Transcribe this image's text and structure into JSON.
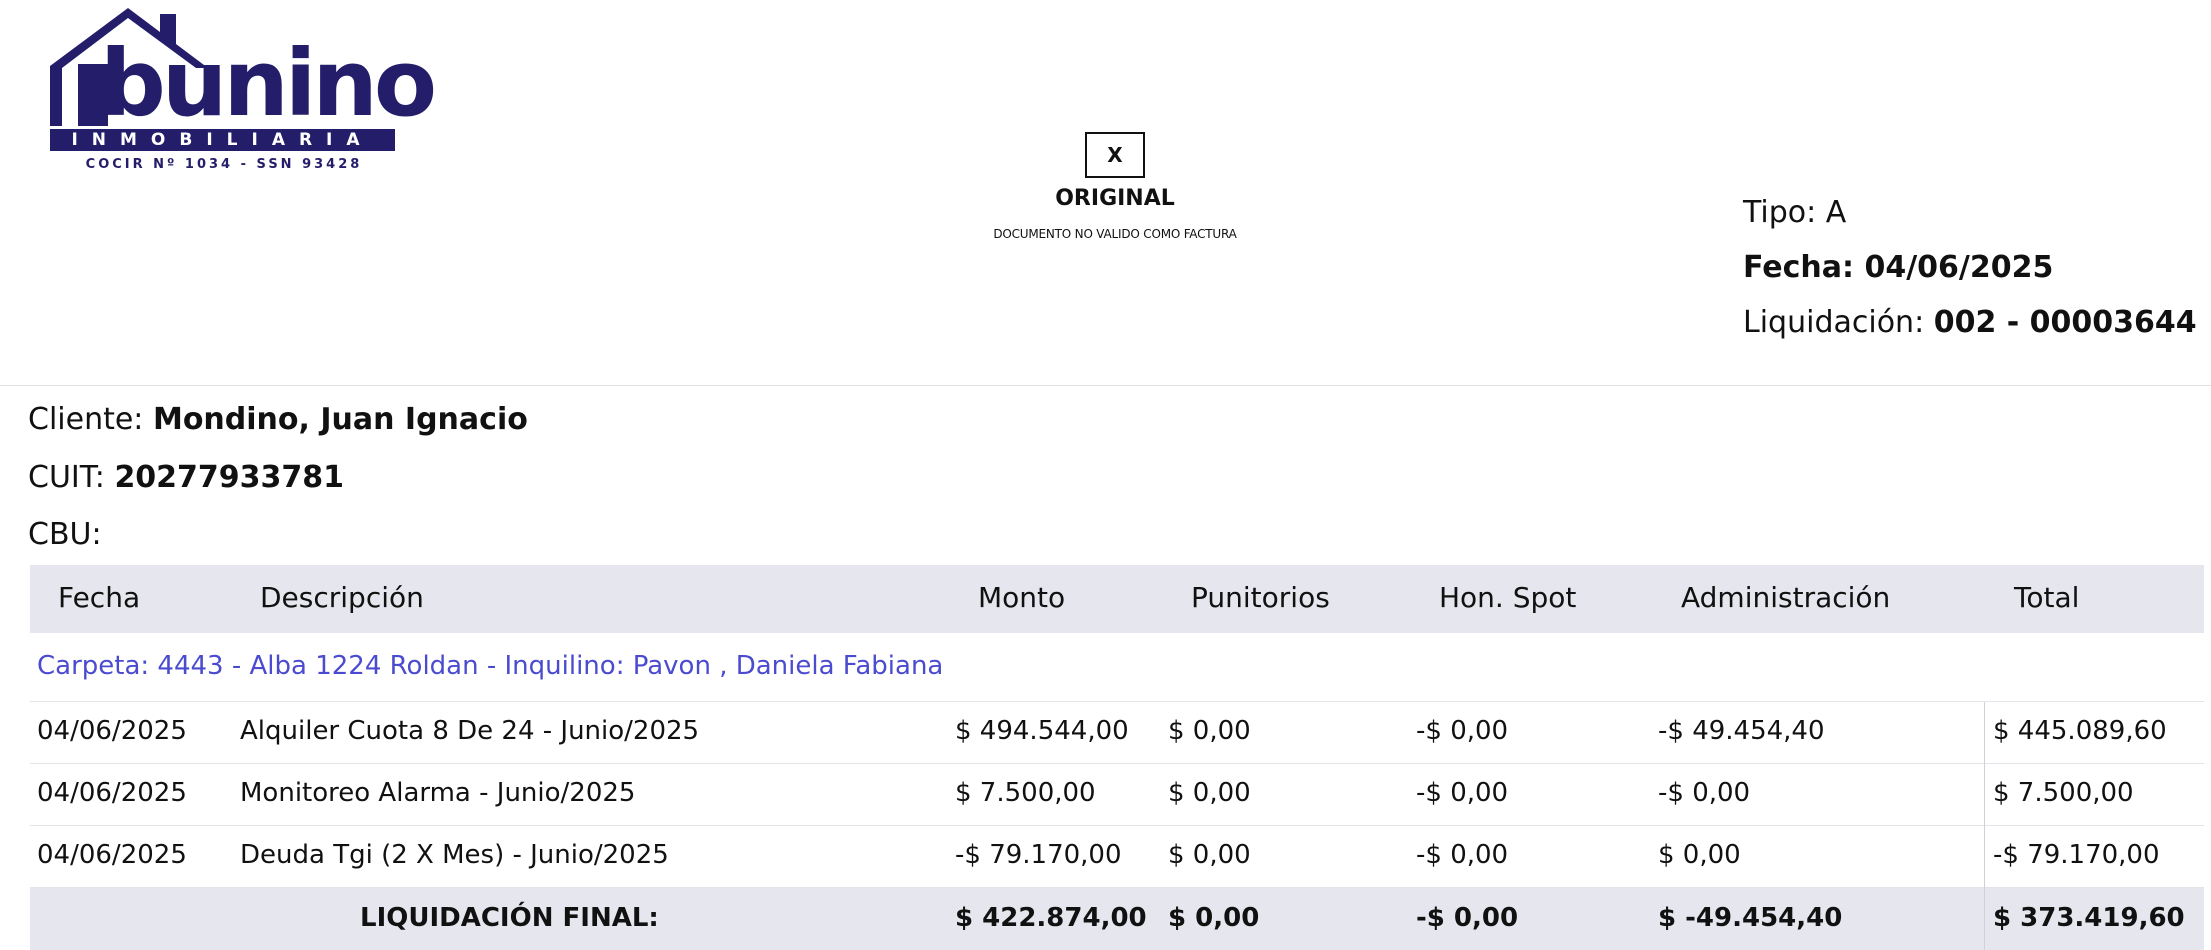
{
  "logo": {
    "brand": "bunino",
    "subtitle": "INMOBILIARIA",
    "registration": "COCIR Nº 1034 - SSN 93428",
    "color": "#241d6a"
  },
  "document": {
    "copy_mark": "X",
    "copy_label": "ORIGINAL",
    "note": "DOCUMENTO NO VALIDO COMO FACTURA"
  },
  "meta": {
    "tipo_label": "Tipo:",
    "tipo_value": "A",
    "fecha_label": "Fecha:",
    "fecha_value": "04/06/2025",
    "liquidacion_label": "Liquidación:",
    "liquidacion_value": "002 - 00003644"
  },
  "client": {
    "cliente_label": "Cliente:",
    "cliente_value": "Mondino, Juan Ignacio",
    "cuit_label": "CUIT:",
    "cuit_value": "20277933781",
    "cbu_label": "CBU:",
    "cbu_value": ""
  },
  "table": {
    "headers": [
      "Fecha",
      "Descripción",
      "Monto",
      "Punitorios",
      "Hon. Spot",
      "Administración",
      "Total"
    ],
    "carpeta": "Carpeta: 4443 - Alba 1224 Roldan - Inquilino: Pavon , Daniela Fabiana",
    "rows": [
      {
        "fecha": "04/06/2025",
        "descripcion": "Alquiler Cuota 8 De 24 - Junio/2025",
        "monto": "$ 494.544,00",
        "punitorios": "$ 0,00",
        "hon_spot": "-$ 0,00",
        "administracion": "-$ 49.454,40",
        "total": "$ 445.089,60"
      },
      {
        "fecha": "04/06/2025",
        "descripcion": "Monitoreo Alarma - Junio/2025",
        "monto": "$ 7.500,00",
        "punitorios": "$ 0,00",
        "hon_spot": "-$ 0,00",
        "administracion": "-$ 0,00",
        "total": "$ 7.500,00"
      },
      {
        "fecha": "04/06/2025",
        "descripcion": "Deuda Tgi (2 X Mes) - Junio/2025",
        "monto": "-$ 79.170,00",
        "punitorios": "$ 0,00",
        "hon_spot": "-$ 0,00",
        "administracion": "$ 0,00",
        "total": "-$ 79.170,00"
      }
    ],
    "footer": {
      "label": "LIQUIDACIÓN FINAL:",
      "monto": "$ 422.874,00",
      "punitorios": "$ 0,00",
      "hon_spot": "-$ 0,00",
      "administracion": "$ -49.454,40",
      "total": "$ 373.419,60"
    },
    "carpeta_color": "#4b4bd0",
    "header_bg": "#e6e7ee"
  }
}
